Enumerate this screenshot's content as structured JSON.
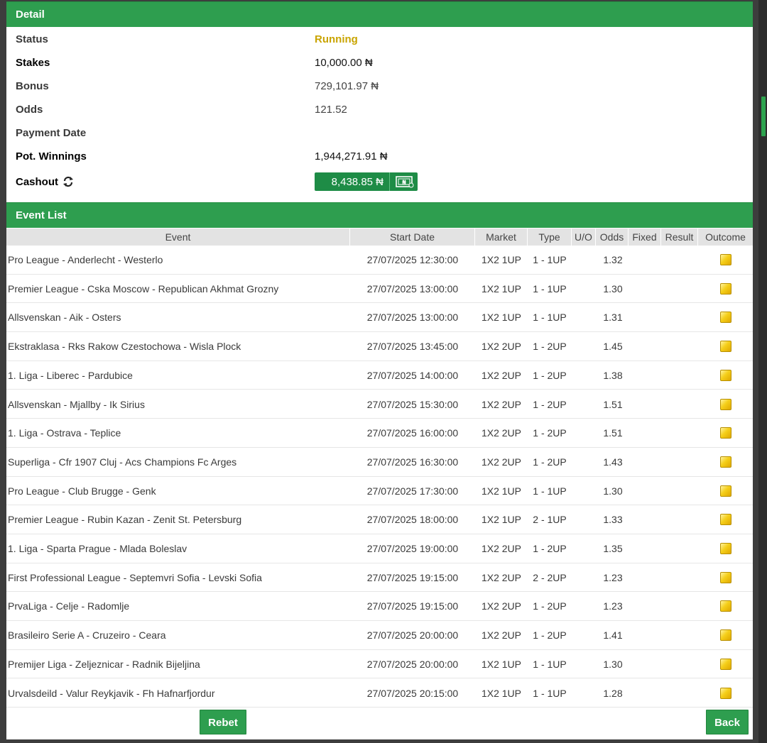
{
  "detail": {
    "header": "Detail",
    "rows": [
      {
        "label": "Status",
        "value": "Running"
      },
      {
        "label": "Stakes",
        "value": "10,000.00 ₦"
      },
      {
        "label": "Bonus",
        "value": "729,101.97 ₦"
      },
      {
        "label": "Odds",
        "value": "121.52"
      },
      {
        "label": "Payment Date",
        "value": ""
      },
      {
        "label": "Pot. Winnings",
        "value": "1,944,271.91 ₦"
      }
    ],
    "cashout_label": "Cashout",
    "cashout_amount": "8,438.85 ₦"
  },
  "events": {
    "header": "Event List",
    "columns": [
      "Event",
      "Start Date",
      "Market",
      "Type",
      "U/O",
      "Odds",
      "Fixed",
      "Result",
      "Outcome"
    ],
    "rows": [
      {
        "event": "Pro League - Anderlecht - Westerlo",
        "date": "27/07/2025 12:30:00",
        "market": "1X2 1UP",
        "type": "1 - 1UP",
        "odds": "1.32"
      },
      {
        "event": "Premier League - Cska Moscow - Republican Akhmat Grozny",
        "date": "27/07/2025 13:00:00",
        "market": "1X2 1UP",
        "type": "1 - 1UP",
        "odds": "1.30"
      },
      {
        "event": "Allsvenskan - Aik - Osters",
        "date": "27/07/2025 13:00:00",
        "market": "1X2 1UP",
        "type": "1 - 1UP",
        "odds": "1.31"
      },
      {
        "event": "Ekstraklasa - Rks Rakow Czestochowa - Wisla Plock",
        "date": "27/07/2025 13:45:00",
        "market": "1X2 2UP",
        "type": "1 - 2UP",
        "odds": "1.45"
      },
      {
        "event": "1. Liga - Liberec - Pardubice",
        "date": "27/07/2025 14:00:00",
        "market": "1X2 2UP",
        "type": "1 - 2UP",
        "odds": "1.38"
      },
      {
        "event": "Allsvenskan - Mjallby - Ik Sirius",
        "date": "27/07/2025 15:30:00",
        "market": "1X2 2UP",
        "type": "1 - 2UP",
        "odds": "1.51"
      },
      {
        "event": "1. Liga - Ostrava - Teplice",
        "date": "27/07/2025 16:00:00",
        "market": "1X2 2UP",
        "type": "1 - 2UP",
        "odds": "1.51"
      },
      {
        "event": "Superliga - Cfr 1907 Cluj - Acs Champions Fc Arges",
        "date": "27/07/2025 16:30:00",
        "market": "1X2 2UP",
        "type": "1 - 2UP",
        "odds": "1.43"
      },
      {
        "event": "Pro League - Club Brugge - Genk",
        "date": "27/07/2025 17:30:00",
        "market": "1X2 1UP",
        "type": "1 - 1UP",
        "odds": "1.30"
      },
      {
        "event": "Premier League - Rubin Kazan - Zenit St. Petersburg",
        "date": "27/07/2025 18:00:00",
        "market": "1X2 1UP",
        "type": "2 - 1UP",
        "odds": "1.33"
      },
      {
        "event": "1. Liga - Sparta Prague - Mlada Boleslav",
        "date": "27/07/2025 19:00:00",
        "market": "1X2 2UP",
        "type": "1 - 2UP",
        "odds": "1.35"
      },
      {
        "event": "First Professional League - Septemvri Sofia - Levski Sofia",
        "date": "27/07/2025 19:15:00",
        "market": "1X2 2UP",
        "type": "2 - 2UP",
        "odds": "1.23"
      },
      {
        "event": "PrvaLiga - Celje - Radomlje",
        "date": "27/07/2025 19:15:00",
        "market": "1X2 2UP",
        "type": "1 - 2UP",
        "odds": "1.23"
      },
      {
        "event": "Brasileiro Serie A - Cruzeiro - Ceara",
        "date": "27/07/2025 20:00:00",
        "market": "1X2 2UP",
        "type": "1 - 2UP",
        "odds": "1.41"
      },
      {
        "event": "Premijer Liga - Zeljeznicar - Radnik Bijeljina",
        "date": "27/07/2025 20:00:00",
        "market": "1X2 1UP",
        "type": "1 - 1UP",
        "odds": "1.30"
      },
      {
        "event": "Urvalsdeild - Valur Reykjavik - Fh Hafnarfjordur",
        "date": "27/07/2025 20:15:00",
        "market": "1X2 1UP",
        "type": "1 - 1UP",
        "odds": "1.28"
      }
    ]
  },
  "actions": {
    "rebet": "Rebet",
    "back": "Back"
  },
  "colors": {
    "accent": "#2e9e4f",
    "status_running": "#c9a400",
    "cashout_button": "#1e8c46"
  }
}
